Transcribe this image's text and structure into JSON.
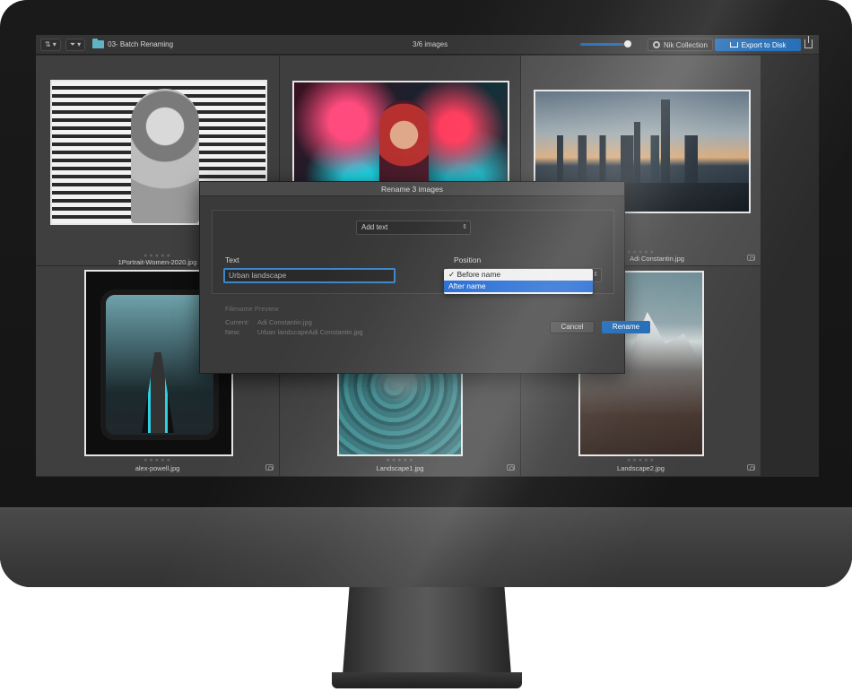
{
  "toolbar": {
    "sort_icon": "sort-icon",
    "filter_icon": "filter-icon",
    "folder_name": "03- Batch Renaming",
    "counter": "3/6 images",
    "thumb_size_fraction": 0.85,
    "nik_label": "Nik Collection",
    "export_label": "Export to Disk",
    "accent": "#1c68b5"
  },
  "grid": {
    "cells": [
      {
        "filename": "1Portrait-Women-2020.jpg",
        "stars": "★★★★★"
      },
      {
        "filename": "",
        "stars": ""
      },
      {
        "filename": "Adi Constantin.jpg",
        "stars": "★★★★★"
      },
      {
        "filename": "alex-powell.jpg",
        "stars": "★★★★★"
      },
      {
        "filename": "Landscape1.jpg",
        "stars": "★★★★★"
      },
      {
        "filename": "Landscape2.jpg",
        "stars": "★★★★★"
      }
    ]
  },
  "dialog": {
    "title": "Rename 3 images",
    "operation": "Add text",
    "text_label": "Text",
    "text_value": "Urban landscape",
    "position_label": "Position",
    "position_options": [
      {
        "label": "✓ Before name",
        "selected": true
      },
      {
        "label": "After name",
        "highlighted": true
      }
    ],
    "preview": {
      "heading": "Filename Preview",
      "current_label": "Current:",
      "current_value": "Adi Constantin.jpg",
      "new_label": "New:",
      "new_value": "Urban landscapeAdi Constantin.jpg"
    },
    "cancel_label": "Cancel",
    "rename_label": "Rename"
  }
}
